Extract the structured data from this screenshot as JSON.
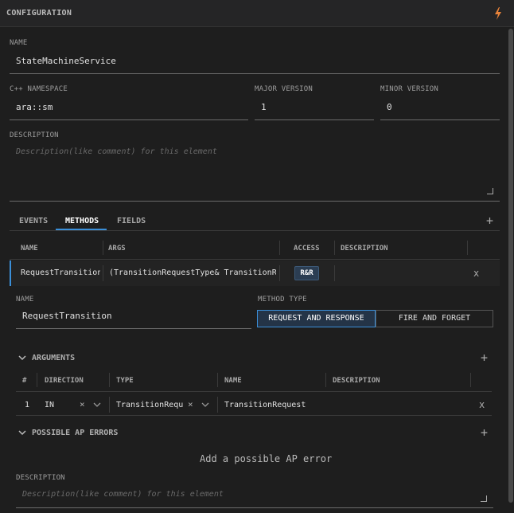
{
  "header": {
    "title": "CONFIGURATION"
  },
  "name": {
    "label": "NAME",
    "value": "StateMachineService"
  },
  "namespace": {
    "label": "C++ NAMESPACE",
    "value": "ara::sm"
  },
  "major_version": {
    "label": "MAJOR VERSION",
    "value": "1"
  },
  "minor_version": {
    "label": "MINOR VERSION",
    "value": "0"
  },
  "description": {
    "label": "DESCRIPTION",
    "placeholder": "Description(like comment) for this element"
  },
  "tabs": [
    {
      "label": "EVENTS"
    },
    {
      "label": "METHODS"
    },
    {
      "label": "FIELDS"
    }
  ],
  "methods_table": {
    "headers": [
      "NAME",
      "ARGS",
      "ACCESS",
      "DESCRIPTION"
    ],
    "rows": [
      {
        "name": "RequestTransition",
        "args": "(TransitionRequestType& TransitionRe...",
        "access": "R&R",
        "description": ""
      }
    ]
  },
  "method_detail": {
    "name_label": "NAME",
    "name_value": "RequestTransition",
    "method_type_label": "METHOD TYPE",
    "method_types": [
      "REQUEST AND RESPONSE",
      "FIRE AND FORGET"
    ],
    "selected_method_type": "REQUEST AND RESPONSE"
  },
  "arguments": {
    "title": "ARGUMENTS",
    "headers": [
      "#",
      "DIRECTION",
      "TYPE",
      "NAME",
      "DESCRIPTION"
    ],
    "rows": [
      {
        "index": "1",
        "direction": "IN",
        "type": "TransitionRequ...",
        "name": "TransitionRequest",
        "description": ""
      }
    ]
  },
  "ap_errors": {
    "title": "POSSIBLE AP ERRORS",
    "empty_text": "Add a possible AP error"
  },
  "method_description": {
    "label": "DESCRIPTION",
    "placeholder": "Description(like comment) for this element"
  },
  "icons": {
    "bolt": "bolt-icon",
    "accent_color": "#3b8fd9",
    "bolt_color": "#e8833a"
  }
}
